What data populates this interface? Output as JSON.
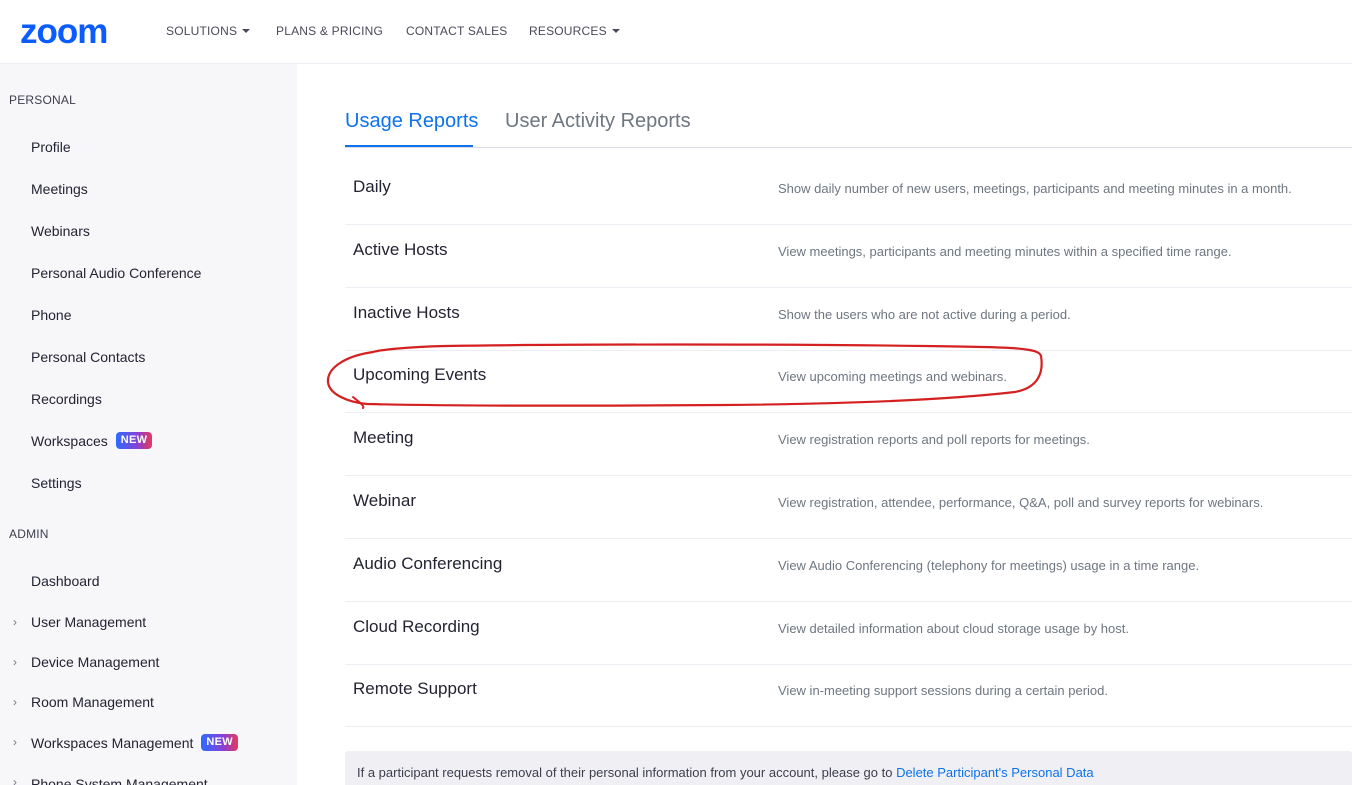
{
  "header": {
    "logo": "zoom",
    "nav": [
      {
        "label": "SOLUTIONS",
        "has_dropdown": true
      },
      {
        "label": "PLANS & PRICING",
        "has_dropdown": false
      },
      {
        "label": "CONTACT SALES",
        "has_dropdown": false
      },
      {
        "label": "RESOURCES",
        "has_dropdown": true
      }
    ]
  },
  "sidebar": {
    "personal_heading": "PERSONAL",
    "personal_items": [
      {
        "label": "Profile"
      },
      {
        "label": "Meetings"
      },
      {
        "label": "Webinars"
      },
      {
        "label": "Personal Audio Conference"
      },
      {
        "label": "Phone"
      },
      {
        "label": "Personal Contacts"
      },
      {
        "label": "Recordings"
      },
      {
        "label": "Workspaces",
        "badge": "NEW"
      },
      {
        "label": "Settings"
      }
    ],
    "admin_heading": "ADMIN",
    "admin_items": [
      {
        "label": "Dashboard"
      },
      {
        "label": "User Management",
        "expandable": true
      },
      {
        "label": "Device Management",
        "expandable": true
      },
      {
        "label": "Room Management",
        "expandable": true
      },
      {
        "label": "Workspaces Management",
        "expandable": true,
        "badge": "NEW"
      },
      {
        "label": "Phone System Management",
        "expandable": true
      }
    ]
  },
  "tabs": [
    {
      "label": "Usage Reports",
      "active": true
    },
    {
      "label": "User Activity Reports",
      "active": false
    }
  ],
  "reports": [
    {
      "name": "Daily",
      "description": "Show daily number of new users, meetings, participants and meeting minutes in a month."
    },
    {
      "name": "Active Hosts",
      "description": "View meetings, participants and meeting minutes within a specified time range."
    },
    {
      "name": "Inactive Hosts",
      "description": "Show the users who are not active during a period."
    },
    {
      "name": "Upcoming Events",
      "description": "View upcoming meetings and webinars."
    },
    {
      "name": "Meeting",
      "description": "View registration reports and poll reports for meetings."
    },
    {
      "name": "Webinar",
      "description": "View registration, attendee, performance, Q&A, poll and survey reports for webinars."
    },
    {
      "name": "Audio Conferencing",
      "description": "View Audio Conferencing (telephony for meetings) usage in a time range."
    },
    {
      "name": "Cloud Recording",
      "description": "View detailed information about cloud storage usage by host."
    },
    {
      "name": "Remote Support",
      "description": "View in-meeting support sessions during a certain period."
    }
  ],
  "notice": {
    "text": "If a participant requests removal of their personal information from your account, please go to ",
    "link": "Delete Participant's Personal Data"
  },
  "colors": {
    "accent": "#0e72ed",
    "annotation": "#d42020",
    "sidebar_bg": "#f7f7fa"
  }
}
